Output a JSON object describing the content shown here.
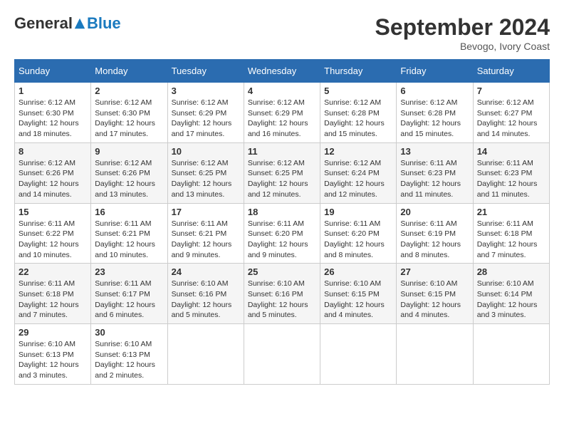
{
  "header": {
    "logo_general": "General",
    "logo_blue": "Blue",
    "month_title": "September 2024",
    "subtitle": "Bevogo, Ivory Coast"
  },
  "days_of_week": [
    "Sunday",
    "Monday",
    "Tuesday",
    "Wednesday",
    "Thursday",
    "Friday",
    "Saturday"
  ],
  "weeks": [
    [
      {
        "day": "1",
        "sunrise": "6:12 AM",
        "sunset": "6:30 PM",
        "daylight": "12 hours and 18 minutes."
      },
      {
        "day": "2",
        "sunrise": "6:12 AM",
        "sunset": "6:30 PM",
        "daylight": "12 hours and 17 minutes."
      },
      {
        "day": "3",
        "sunrise": "6:12 AM",
        "sunset": "6:29 PM",
        "daylight": "12 hours and 17 minutes."
      },
      {
        "day": "4",
        "sunrise": "6:12 AM",
        "sunset": "6:29 PM",
        "daylight": "12 hours and 16 minutes."
      },
      {
        "day": "5",
        "sunrise": "6:12 AM",
        "sunset": "6:28 PM",
        "daylight": "12 hours and 15 minutes."
      },
      {
        "day": "6",
        "sunrise": "6:12 AM",
        "sunset": "6:28 PM",
        "daylight": "12 hours and 15 minutes."
      },
      {
        "day": "7",
        "sunrise": "6:12 AM",
        "sunset": "6:27 PM",
        "daylight": "12 hours and 14 minutes."
      }
    ],
    [
      {
        "day": "8",
        "sunrise": "6:12 AM",
        "sunset": "6:26 PM",
        "daylight": "12 hours and 14 minutes."
      },
      {
        "day": "9",
        "sunrise": "6:12 AM",
        "sunset": "6:26 PM",
        "daylight": "12 hours and 13 minutes."
      },
      {
        "day": "10",
        "sunrise": "6:12 AM",
        "sunset": "6:25 PM",
        "daylight": "12 hours and 13 minutes."
      },
      {
        "day": "11",
        "sunrise": "6:12 AM",
        "sunset": "6:25 PM",
        "daylight": "12 hours and 12 minutes."
      },
      {
        "day": "12",
        "sunrise": "6:12 AM",
        "sunset": "6:24 PM",
        "daylight": "12 hours and 12 minutes."
      },
      {
        "day": "13",
        "sunrise": "6:11 AM",
        "sunset": "6:23 PM",
        "daylight": "12 hours and 11 minutes."
      },
      {
        "day": "14",
        "sunrise": "6:11 AM",
        "sunset": "6:23 PM",
        "daylight": "12 hours and 11 minutes."
      }
    ],
    [
      {
        "day": "15",
        "sunrise": "6:11 AM",
        "sunset": "6:22 PM",
        "daylight": "12 hours and 10 minutes."
      },
      {
        "day": "16",
        "sunrise": "6:11 AM",
        "sunset": "6:21 PM",
        "daylight": "12 hours and 10 minutes."
      },
      {
        "day": "17",
        "sunrise": "6:11 AM",
        "sunset": "6:21 PM",
        "daylight": "12 hours and 9 minutes."
      },
      {
        "day": "18",
        "sunrise": "6:11 AM",
        "sunset": "6:20 PM",
        "daylight": "12 hours and 9 minutes."
      },
      {
        "day": "19",
        "sunrise": "6:11 AM",
        "sunset": "6:20 PM",
        "daylight": "12 hours and 8 minutes."
      },
      {
        "day": "20",
        "sunrise": "6:11 AM",
        "sunset": "6:19 PM",
        "daylight": "12 hours and 8 minutes."
      },
      {
        "day": "21",
        "sunrise": "6:11 AM",
        "sunset": "6:18 PM",
        "daylight": "12 hours and 7 minutes."
      }
    ],
    [
      {
        "day": "22",
        "sunrise": "6:11 AM",
        "sunset": "6:18 PM",
        "daylight": "12 hours and 7 minutes."
      },
      {
        "day": "23",
        "sunrise": "6:11 AM",
        "sunset": "6:17 PM",
        "daylight": "12 hours and 6 minutes."
      },
      {
        "day": "24",
        "sunrise": "6:10 AM",
        "sunset": "6:16 PM",
        "daylight": "12 hours and 5 minutes."
      },
      {
        "day": "25",
        "sunrise": "6:10 AM",
        "sunset": "6:16 PM",
        "daylight": "12 hours and 5 minutes."
      },
      {
        "day": "26",
        "sunrise": "6:10 AM",
        "sunset": "6:15 PM",
        "daylight": "12 hours and 4 minutes."
      },
      {
        "day": "27",
        "sunrise": "6:10 AM",
        "sunset": "6:15 PM",
        "daylight": "12 hours and 4 minutes."
      },
      {
        "day": "28",
        "sunrise": "6:10 AM",
        "sunset": "6:14 PM",
        "daylight": "12 hours and 3 minutes."
      }
    ],
    [
      {
        "day": "29",
        "sunrise": "6:10 AM",
        "sunset": "6:13 PM",
        "daylight": "12 hours and 3 minutes."
      },
      {
        "day": "30",
        "sunrise": "6:10 AM",
        "sunset": "6:13 PM",
        "daylight": "12 hours and 2 minutes."
      },
      null,
      null,
      null,
      null,
      null
    ]
  ]
}
